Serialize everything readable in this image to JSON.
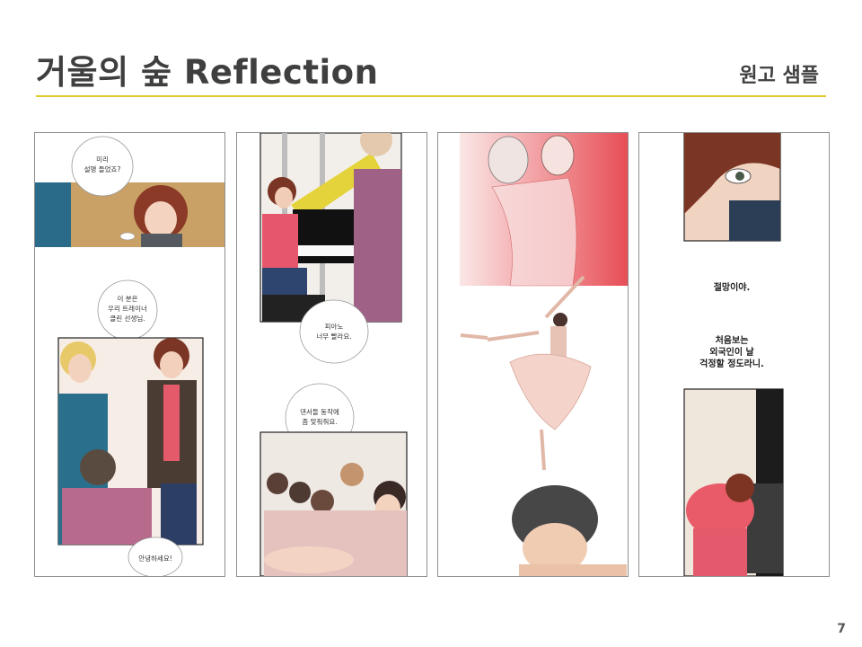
{
  "slide": {
    "title": "거울의 숲 Reflection",
    "subtitle": "원고 샘플",
    "page_number": "7"
  },
  "strip1": {
    "bubble1": [
      "미리",
      "설명 들었죠?"
    ],
    "bubble2": [
      "이 분은",
      "우리 트레이너",
      "클린 선생님."
    ],
    "bubble3": "안녕하세요!"
  },
  "strip2": {
    "bubble1": [
      "피아노",
      "너무 빨라요."
    ],
    "bubble2": [
      "댄서들 동작에",
      "좀 맞춰줘요."
    ]
  },
  "strip4": {
    "caption1": "절망이야.",
    "caption2": [
      "처음보는",
      "외국인이 날",
      "걱정할 정도라니."
    ]
  },
  "colors": {
    "accent_rule": "#e2c92c",
    "title": "#3f3f3f"
  }
}
